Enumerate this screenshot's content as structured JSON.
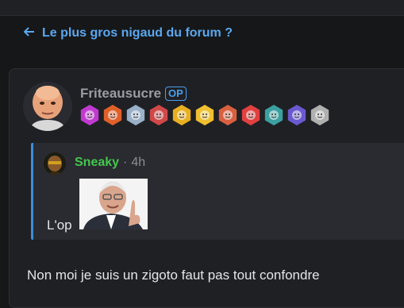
{
  "header": {
    "back_arrow_icon": "arrow-left-icon",
    "thread_title": "Le plus gros nigaud du forum ?"
  },
  "post": {
    "author": "Friteausucre",
    "op_label": "OP",
    "avatar_icon": "bald-man-avatar",
    "badges": [
      {
        "name": "spiral-badge-icon",
        "color": "#c03ad0"
      },
      {
        "name": "clown-badge-icon",
        "color": "#e0602a"
      },
      {
        "name": "face-badge-icon",
        "color": "#9ab0c8"
      },
      {
        "name": "face-badge-icon",
        "color": "#d04848"
      },
      {
        "name": "rainbow-badge-icon",
        "color": "#e8b020"
      },
      {
        "name": "face-badge-icon",
        "color": "#f0c030"
      },
      {
        "name": "face-badge-icon",
        "color": "#d86040"
      },
      {
        "name": "face-badge-icon",
        "color": "#e04040"
      },
      {
        "name": "animal-badge-icon",
        "color": "#3ca0a0"
      },
      {
        "name": "moon-badge-icon",
        "color": "#6a5ad0"
      },
      {
        "name": "face-badge-icon",
        "color": "#b0b0b0"
      }
    ],
    "quote": {
      "author": "Sneaky",
      "separator": "·",
      "time": "4h",
      "text": "L'op",
      "image_icon": "old-man-pointing-meme"
    },
    "body": "Non moi je suis un zigoto faut pas tout confondre"
  }
}
